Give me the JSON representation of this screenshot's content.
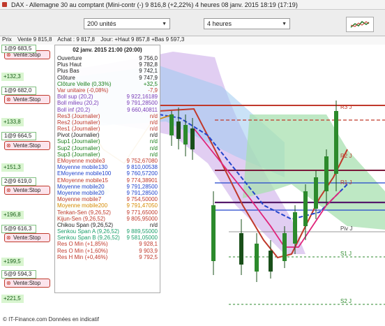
{
  "window": {
    "title": "DAX - Allemagne 30 au comptant (Mini-contr (-)   9 816,8 (+2,22%)   4 heures  08 janv. 2015 18:19 (17:19)"
  },
  "toolbar": {
    "quantity": "200 unités",
    "period": "4 heures"
  },
  "subbar": {
    "prix": "Prix",
    "vente": "Vente 9 815,8",
    "achat": "Achat : 9 817,8",
    "jour": "Jour: +Haut 9 857,8 +Bas 9 597,3"
  },
  "left_panel": {
    "rows": [
      {
        "value": "1@9 683,5",
        "sub": "+132,3"
      },
      {
        "value": "1@9 682,0",
        "sub": "+133,8"
      },
      {
        "value": "1@9 664,5",
        "sub": "+151,3"
      },
      {
        "value": "2@9 619,0",
        "sub": "+196,8"
      },
      {
        "value": "5@9 616,3",
        "sub": "+199,5"
      },
      {
        "value": "5@9 594,3",
        "sub": "+221,5"
      }
    ],
    "stop_label": "Vente:Stop"
  },
  "tooltip": {
    "title": "02 janv. 2015 21:00 (20:00)",
    "rows": [
      {
        "label": "Ouverture",
        "value": "9 756,0",
        "color": "#222222"
      },
      {
        "label": "Plus Haut",
        "value": "9 782,8",
        "color": "#222222"
      },
      {
        "label": "Plus Bas",
        "value": "9 742,1",
        "color": "#222222"
      },
      {
        "label": "Clôture",
        "value": "9 747,9",
        "color": "#222222"
      },
      {
        "label": "Clôture Veille (0,33%)",
        "value": "+32,5",
        "color": "#1a7f1a"
      },
      {
        "label": "Var unitaire (-0,08%)",
        "value": "-7,9",
        "color": "#c0392b"
      },
      {
        "label": "Boll sup (20,2)",
        "value": "9 922,16189",
        "color": "#7a3db8"
      },
      {
        "label": "Boll milieu (20,2)",
        "value": "9 791,28500",
        "color": "#7a3db8"
      },
      {
        "label": "Boll inf (20,2)",
        "value": "9 660,40811",
        "color": "#7a3db8"
      },
      {
        "label": "Res3 (Journalier)",
        "value": "n/d",
        "color": "#c0392b"
      },
      {
        "label": "Res2 (Journalier)",
        "value": "n/d",
        "color": "#c0392b"
      },
      {
        "label": "Res1 (Journalier)",
        "value": "n/d",
        "color": "#c0392b"
      },
      {
        "label": "Pivot (Journalier)",
        "value": "n/d",
        "color": "#222222"
      },
      {
        "label": "Sup1 (Journalier)",
        "value": "n/d",
        "color": "#1a7f1a"
      },
      {
        "label": "Sup2 (Journalier)",
        "value": "n/d",
        "color": "#1a7f1a"
      },
      {
        "label": "Sup3 (Journalier)",
        "value": "n/d",
        "color": "#1a7f1a"
      },
      {
        "label": "EMoyenne mobile3",
        "value": "9 752,67080",
        "color": "#c0392b"
      },
      {
        "label": "Moyenne mobile130",
        "value": "9 810,00538",
        "color": "#2244cc"
      },
      {
        "label": "EMoyenne mobile100",
        "value": "9 760,57200",
        "color": "#2244cc"
      },
      {
        "label": "EMoyenne mobile15",
        "value": "9 774,38901",
        "color": "#c0392b"
      },
      {
        "label": "Moyenne mobile20",
        "value": "9 791,28500",
        "color": "#2244cc"
      },
      {
        "label": "Moyenne mobile20",
        "value": "9 791,28500",
        "color": "#2244cc"
      },
      {
        "label": "Moyenne mobile7",
        "value": "9 754,50000",
        "color": "#c0392b"
      },
      {
        "label": "Moyenne mobile200",
        "value": "9 791,47050",
        "color": "#d68a00"
      },
      {
        "label": "Tenkan-Sen (9,26,52)",
        "value": "9 771,65000",
        "color": "#c0392b"
      },
      {
        "label": "Kijun-Sen (9,26,52)",
        "value": "9 805,95000",
        "color": "#c0392b"
      },
      {
        "label": "Chikou Span (9,26,52)",
        "value": "n/d",
        "color": "#222222"
      },
      {
        "label": "Senkou Span A (9,26,52)",
        "value": "9 889,55000",
        "color": "#1a9f6a"
      },
      {
        "label": "Senkou Span B (9,26,52)",
        "value": "9 581,05000",
        "color": "#1a9f6a"
      },
      {
        "label": "Res O Min (+1,85%)",
        "value": "9 928,1",
        "color": "#c0392b"
      },
      {
        "label": "Res O Min (+1,60%)",
        "value": "9 903,9",
        "color": "#c0392b"
      },
      {
        "label": "Res H Min (+0,46%)",
        "value": "9 792,5",
        "color": "#c0392b"
      }
    ]
  },
  "chart": {
    "labels": {
      "r3": "R3 J",
      "r2": "R2 J",
      "r1": "R1 J",
      "piv": "Piv J",
      "s1": "S1 J",
      "s2": "S2 J"
    }
  },
  "footer": {
    "text": "© IT-Finance.com  Données en indicatif"
  },
  "colors": {
    "bollinger_fill": "#c9a6e8",
    "cloud_fill": "#a8e0b0",
    "blue_fill": "#9ecbf0",
    "candle_up": "#2c8a2c",
    "candle_down": "#1a4f1a"
  }
}
